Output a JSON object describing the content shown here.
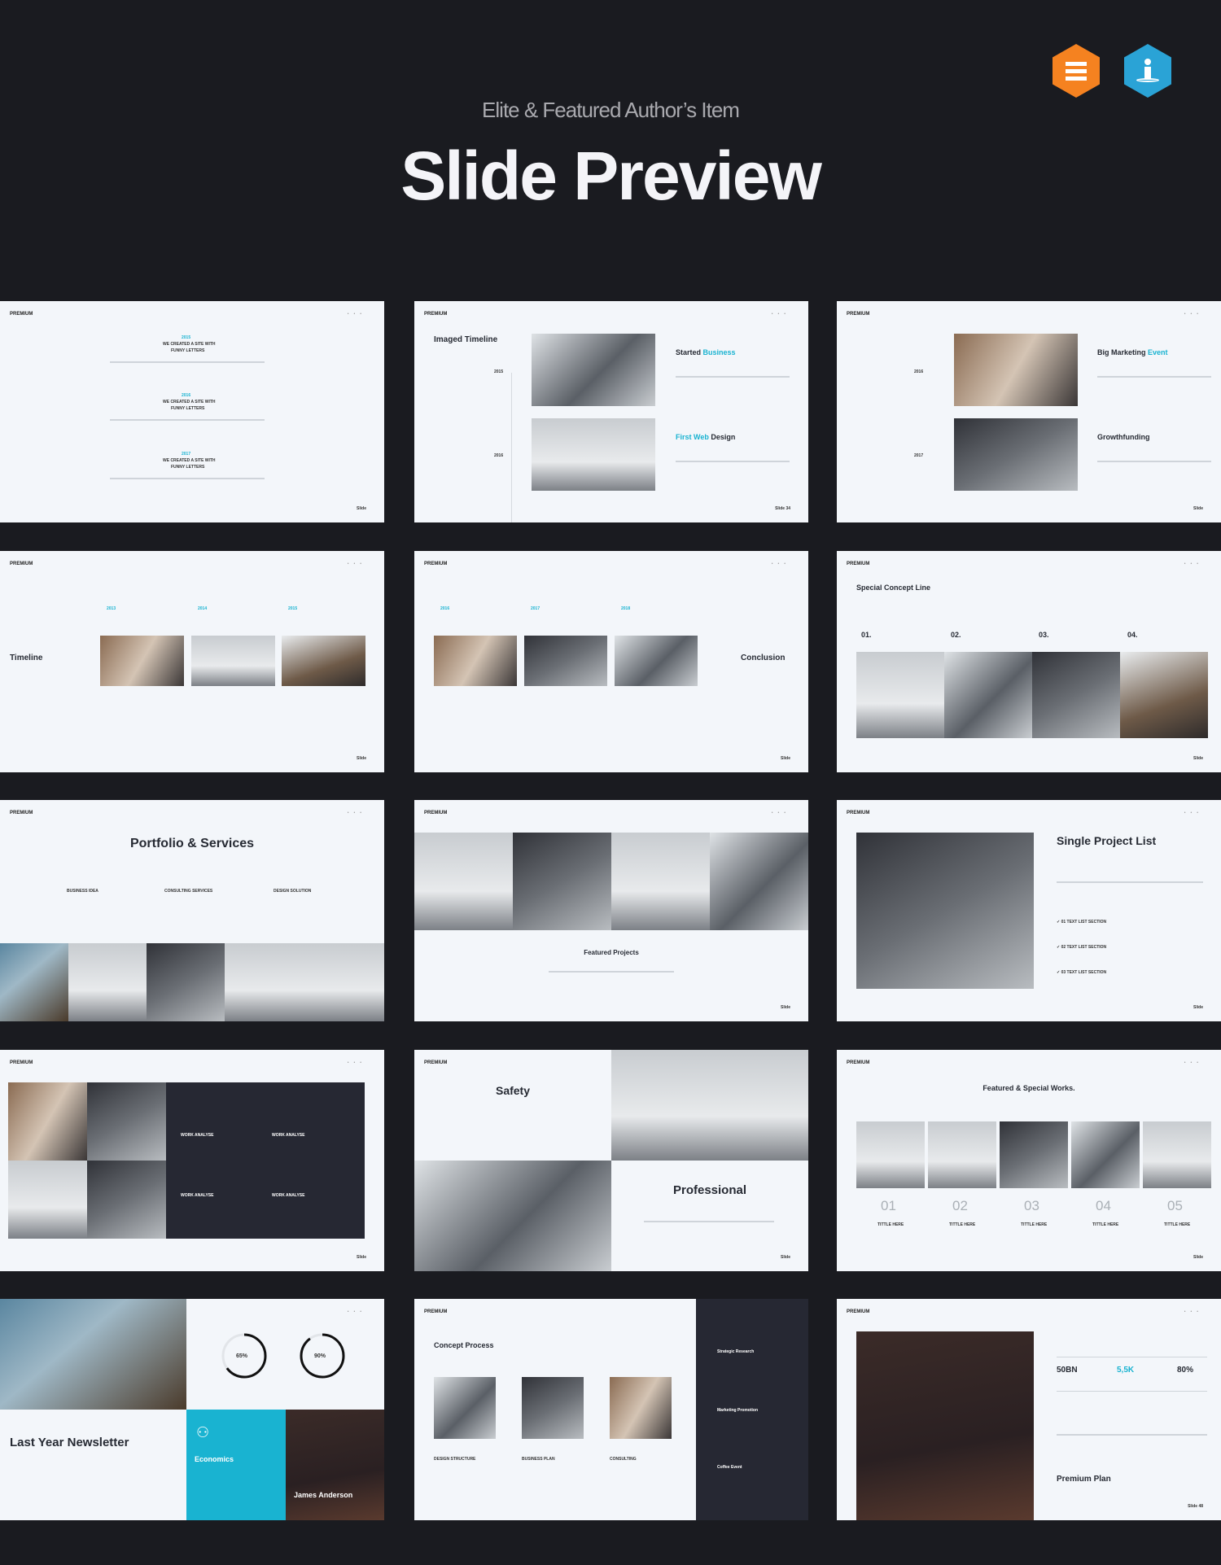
{
  "header": {
    "subtitle": "Elite & Featured Author’s Item",
    "title": "Slide Preview",
    "badges": [
      {
        "icon": "elite-author-badge-icon",
        "color": "#f58220"
      },
      {
        "icon": "featured-author-badge-icon",
        "color": "#2aa3d6"
      }
    ]
  },
  "colors": {
    "background": "#1a1b20",
    "slide": "#f3f6fa",
    "accent": "#19b3d1",
    "dark_panel": "#262833"
  },
  "brand": "PREMIUM",
  "slide_label": "Slide",
  "slides": {
    "s1": {
      "years": [
        "2015",
        "2016",
        "2017"
      ],
      "item": "WE CREATED A SITE WITH",
      "item2": "FUNNY LETTERS"
    },
    "s2": {
      "title": "Imaged Timeline",
      "years": [
        "2015",
        "2016"
      ],
      "h1a": "Started",
      "h1b": "Business",
      "h2a": "First Web",
      "h2b": "Design",
      "num": "34"
    },
    "s3": {
      "title_a": "Big Marketing",
      "title_b": "Event",
      "title2": "Growthfunding",
      "years": [
        "2016",
        "2017"
      ]
    },
    "s4": {
      "title": "Timeline",
      "years": [
        "2013",
        "2014",
        "2015"
      ]
    },
    "s5": {
      "title": "Conclusion",
      "years": [
        "2016",
        "2017",
        "2018"
      ]
    },
    "s6": {
      "title": "Special Concept Line",
      "nums": [
        "01.",
        "02.",
        "03.",
        "04."
      ]
    },
    "s7": {
      "title": "Portfolio & Services",
      "cols": [
        "BUSINESS IDEA",
        "CONSULTING SERVICES",
        "DESIGN SOLUTION"
      ]
    },
    "s8": {
      "title": "Featured Projects"
    },
    "s9": {
      "title": "Single Project List",
      "items": [
        "01 TEXT LIST SECTION",
        "02 TEXT LIST SECTION",
        "03 TEXT LIST SECTION"
      ]
    },
    "s10": {
      "items": [
        "WORK ANALYSE",
        "WORK ANALYSE",
        "WORK ANALYSE",
        "WORK ANALYSE"
      ]
    },
    "s11": {
      "title": "Safety",
      "title2": "Professional"
    },
    "s12": {
      "title": "Featured & Special Works.",
      "nums": [
        "01",
        "02",
        "03",
        "04",
        "05"
      ],
      "label": "TITTLE HERE"
    },
    "s13": {
      "title": "Last Year Newsletter",
      "stat1": "65%",
      "stat2": "90%",
      "progress": [
        0.65,
        0.9
      ],
      "panel_title": "Economics",
      "person": "James Anderson"
    },
    "s14": {
      "title": "Concept Process",
      "cols": [
        "DESIGN STRUCTURE",
        "BUSINESS PLAN",
        "CONSULTING"
      ],
      "side": [
        "Strategic Research",
        "Marketing Promotion",
        "Coffee Event"
      ]
    },
    "s15": {
      "title": "Premium Plan",
      "stats": [
        "50BN",
        "5,5K",
        "80%"
      ],
      "num": "48"
    }
  }
}
